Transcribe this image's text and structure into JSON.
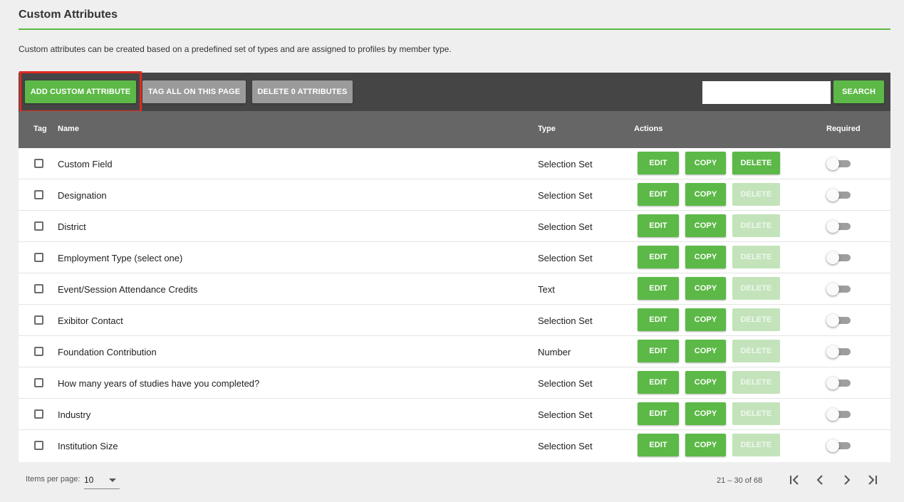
{
  "page": {
    "title": "Custom Attributes",
    "description": "Custom attributes can be created based on a predefined set of types and are assigned to profiles by member type."
  },
  "toolbar": {
    "add_label": "ADD CUSTOM ATTRIBUTE",
    "tag_all_label": "TAG ALL ON THIS PAGE",
    "delete_label": "DELETE 0 ATTRIBUTES",
    "search_value": "",
    "search_label": "SEARCH"
  },
  "table": {
    "headers": {
      "tag": "Tag",
      "name": "Name",
      "type": "Type",
      "actions": "Actions",
      "required": "Required"
    },
    "action_labels": {
      "edit": "EDIT",
      "copy": "COPY",
      "delete": "DELETE"
    },
    "rows": [
      {
        "name": "Custom Field",
        "type": "Selection Set",
        "tagged": false,
        "delete_enabled": true,
        "required": false
      },
      {
        "name": "Designation",
        "type": "Selection Set",
        "tagged": false,
        "delete_enabled": false,
        "required": false
      },
      {
        "name": "District",
        "type": "Selection Set",
        "tagged": false,
        "delete_enabled": false,
        "required": false
      },
      {
        "name": "Employment Type (select one)",
        "type": "Selection Set",
        "tagged": false,
        "delete_enabled": false,
        "required": false
      },
      {
        "name": "Event/Session Attendance Credits",
        "type": "Text",
        "tagged": false,
        "delete_enabled": false,
        "required": false
      },
      {
        "name": "Exibitor Contact",
        "type": "Selection Set",
        "tagged": false,
        "delete_enabled": false,
        "required": false
      },
      {
        "name": "Foundation Contribution",
        "type": "Number",
        "tagged": false,
        "delete_enabled": false,
        "required": false
      },
      {
        "name": "How many years of studies have you completed?",
        "type": "Selection Set",
        "tagged": false,
        "delete_enabled": false,
        "required": false
      },
      {
        "name": "Industry",
        "type": "Selection Set",
        "tagged": false,
        "delete_enabled": false,
        "required": false
      },
      {
        "name": "Institution Size",
        "type": "Selection Set",
        "tagged": false,
        "delete_enabled": false,
        "required": false
      }
    ]
  },
  "paginator": {
    "items_per_page_label": "Items per page:",
    "items_per_page": "10",
    "range_label": "21 – 30 of 68",
    "icons": [
      "first-page-icon",
      "previous-page-icon",
      "next-page-icon",
      "last-page-icon"
    ]
  },
  "colors": {
    "accent_green": "#5cb947",
    "toolbar_bg": "#454545",
    "header_bg": "#666666",
    "highlight_red": "#e02a1f",
    "disabled_green": "#c3e3bb"
  }
}
